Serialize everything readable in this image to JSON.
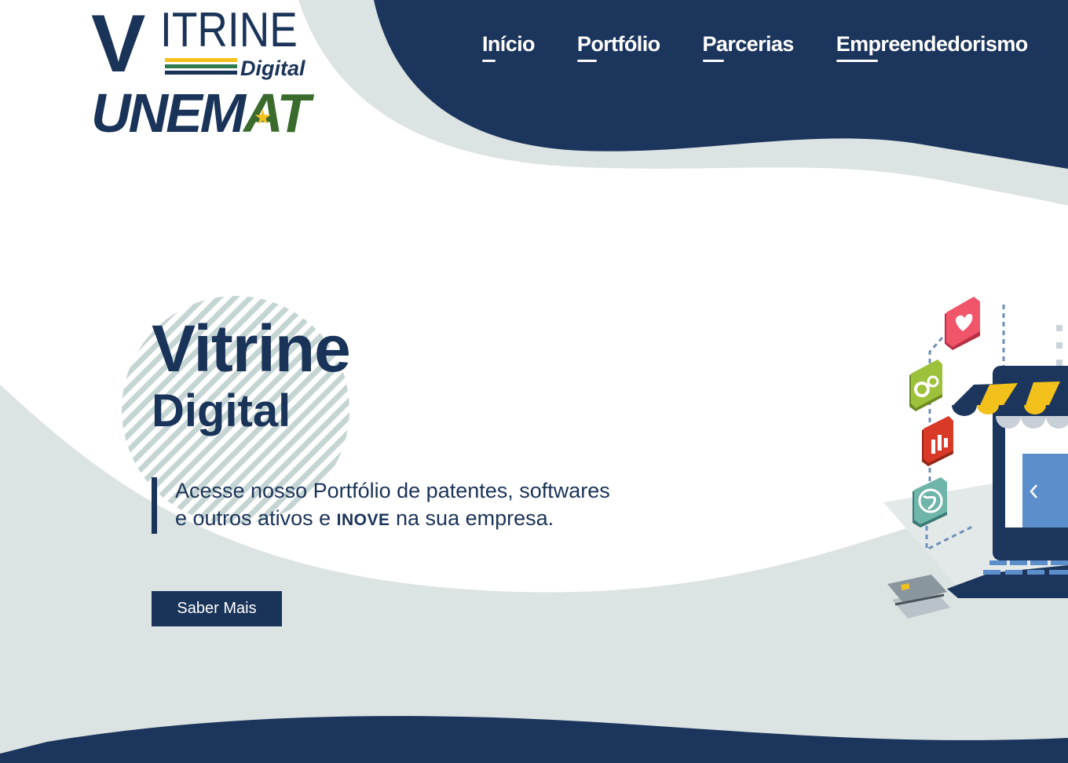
{
  "logo": {
    "letter_v": "V",
    "word_itrine": "ITRINE",
    "word_digital": "Digital",
    "word_unemat_part1": "UNEM",
    "word_unemat_part2": "AT",
    "colors": {
      "navy": "#1a3358",
      "green": "#2d7a4e",
      "yellow": "#f3c11b"
    }
  },
  "nav": {
    "items": [
      {
        "label": "Início"
      },
      {
        "label": "Portfólio"
      },
      {
        "label": "Parcerias"
      },
      {
        "label": "Empreendedorismo"
      }
    ]
  },
  "hero": {
    "title": "Vitrine",
    "subtitle": "Digital",
    "description_part1": "Acesse nosso Portfólio de patentes, softwares e outros ativos e",
    "description_highlight": "INOVE",
    "description_part2": "na sua empresa.",
    "cta_label": "Saber Mais"
  },
  "illustration": {
    "icons": [
      "heart-icon",
      "gears-icon",
      "bar-chart-icon",
      "globe-icon",
      "credit-card-icon",
      "chevron-left-icon"
    ]
  },
  "theme": {
    "navy": "#1a3358",
    "light_gray": "#dce3e3",
    "white": "#ffffff",
    "stripe_gray": "#b9cccc"
  }
}
